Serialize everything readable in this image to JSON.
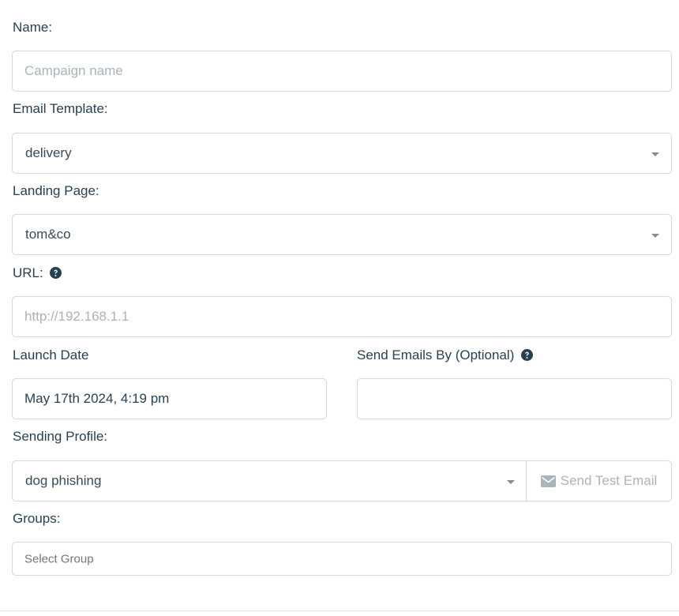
{
  "form": {
    "name": {
      "label": "Name:",
      "placeholder": "Campaign name",
      "value": ""
    },
    "email_template": {
      "label": "Email Template:",
      "selected": "delivery"
    },
    "landing_page": {
      "label": "Landing Page:",
      "selected": "tom&co"
    },
    "url": {
      "label": "URL:",
      "placeholder": "http://192.168.1.1",
      "value": ""
    },
    "launch_date": {
      "label": "Launch Date",
      "value": "May 17th 2024, 4:19 pm"
    },
    "send_by": {
      "label": "Send Emails By (Optional)",
      "value": ""
    },
    "sending_profile": {
      "label": "Sending Profile:",
      "selected": "dog phishing",
      "test_button_label": "Send Test Email"
    },
    "groups": {
      "label": "Groups:",
      "placeholder": "Select Group"
    }
  },
  "icons": {
    "help": "question-circle-icon",
    "envelope": "envelope-icon",
    "dropdown": "caret-down-icon"
  },
  "colors": {
    "text": "#283f50",
    "border": "#d7d7d7",
    "placeholder": "#a8b3bb",
    "muted_button": "#a9b4bc"
  }
}
